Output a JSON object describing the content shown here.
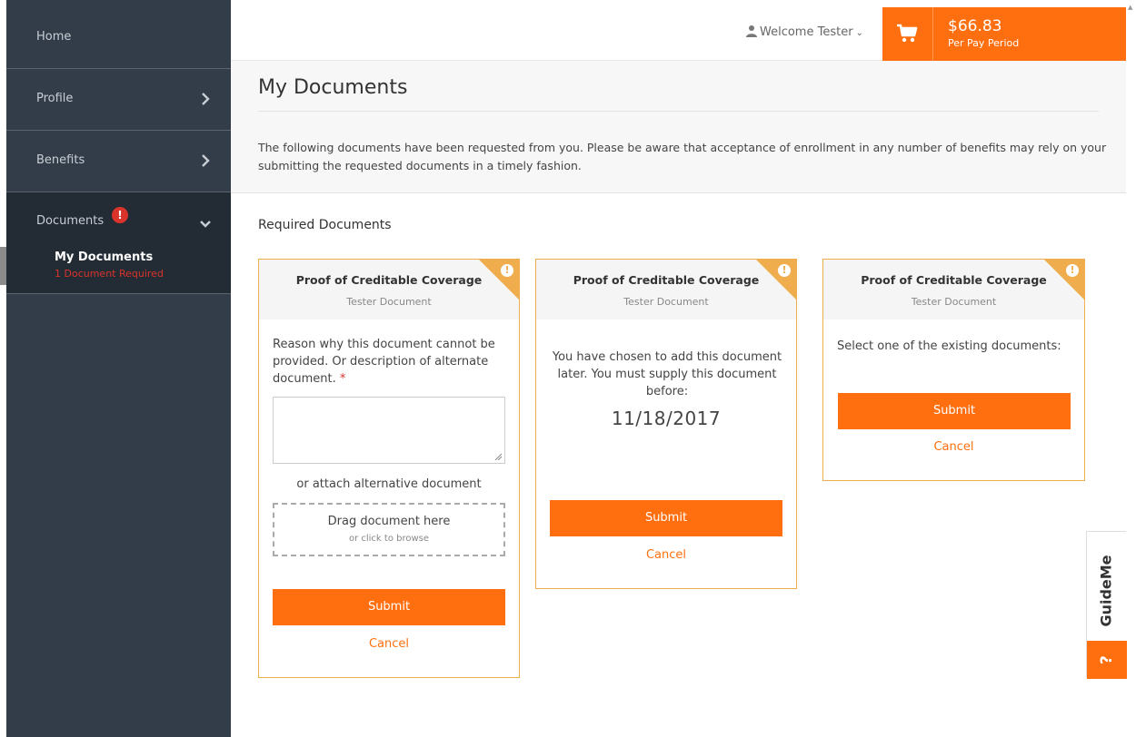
{
  "sidebar": {
    "items": [
      {
        "label": "Home"
      },
      {
        "label": "Profile"
      },
      {
        "label": "Benefits"
      },
      {
        "label": "Documents",
        "badge": "!"
      }
    ],
    "active_sub": {
      "label": "My Documents",
      "note": "1 Document Required"
    }
  },
  "header": {
    "welcome": "Welcome Tester",
    "cart_icon": "shopping-cart-icon",
    "price": "$66.83",
    "period": "Per Pay Period"
  },
  "page": {
    "title": "My Documents",
    "intro": "The following documents have been requested from you. Please be aware that acceptance of enrollment in any number of benefits may rely on your submitting the requested documents in a timely fashion.",
    "section_heading": "Required Documents"
  },
  "cards": [
    {
      "title": "Proof of Creditable Coverage",
      "subtitle": "Tester Document",
      "corner_icon": "!",
      "reason_label": "Reason why this document cannot be provided. Or description of alternate document.",
      "required_marker": "*",
      "or_attach": "or attach alternative document",
      "drop_main": "Drag document here",
      "drop_sub": "or click to browse",
      "submit": "Submit",
      "cancel": "Cancel"
    },
    {
      "title": "Proof of Creditable Coverage",
      "subtitle": "Tester Document",
      "corner_icon": "!",
      "message": "You have chosen to add this document later. You must supply this document before:",
      "date": "11/18/2017",
      "submit": "Submit",
      "cancel": "Cancel"
    },
    {
      "title": "Proof of Creditable Coverage",
      "subtitle": "Tester Document",
      "corner_icon": "!",
      "message": "Select one of the existing documents:",
      "submit": "Submit",
      "cancel": "Cancel"
    }
  ],
  "guideme": {
    "label": "GuideMe",
    "icon": "?"
  },
  "colors": {
    "accent": "#ff6f0f",
    "warning": "#f0ad4e",
    "sidebar": "#333d4a",
    "danger": "#d9342b"
  }
}
